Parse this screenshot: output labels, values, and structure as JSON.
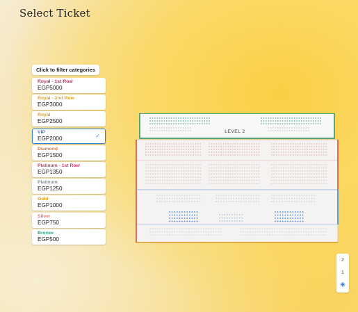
{
  "page": {
    "title": "Select Ticket"
  },
  "filter": {
    "hint": "Click to filter categories"
  },
  "categories": [
    {
      "name": "Royal - 1st Row",
      "price": "EGP5000",
      "color": "#b5305a",
      "selected": false
    },
    {
      "name": "Royal - 2nd Row",
      "price": "EGP3000",
      "color": "#e0a21f",
      "selected": false
    },
    {
      "name": "Royal",
      "price": "EGP2500",
      "color": "#e0a21f",
      "selected": false
    },
    {
      "name": "VIP",
      "price": "EGP2000",
      "color": "#2f7fd8",
      "selected": true
    },
    {
      "name": "Diamond",
      "price": "EGP1500",
      "color": "#e07a3c",
      "selected": false
    },
    {
      "name": "Platinum - 1st Row",
      "price": "EGP1350",
      "color": "#d4356b",
      "selected": false
    },
    {
      "name": "Platinum",
      "price": "EGP1250",
      "color": "#7a8fa6",
      "selected": false
    },
    {
      "name": "Gold",
      "price": "EGP1000",
      "color": "#e0a21f",
      "selected": false
    },
    {
      "name": "Silver",
      "price": "EGP750",
      "color": "#e07a6a",
      "selected": false
    },
    {
      "name": "Bronze",
      "price": "EGP500",
      "color": "#2aa58a",
      "selected": false
    }
  ],
  "venue": {
    "level_label": "LEVEL 2",
    "colors": {
      "level2_border": "#2a8f6b",
      "royal": "#d8413a",
      "vip": "#2f7fd8",
      "gold": "#d8961f",
      "highlight_seat": "#2f7fd8"
    }
  },
  "floor_switcher": {
    "levels": [
      "2",
      "1"
    ],
    "icon": "layers-icon"
  }
}
